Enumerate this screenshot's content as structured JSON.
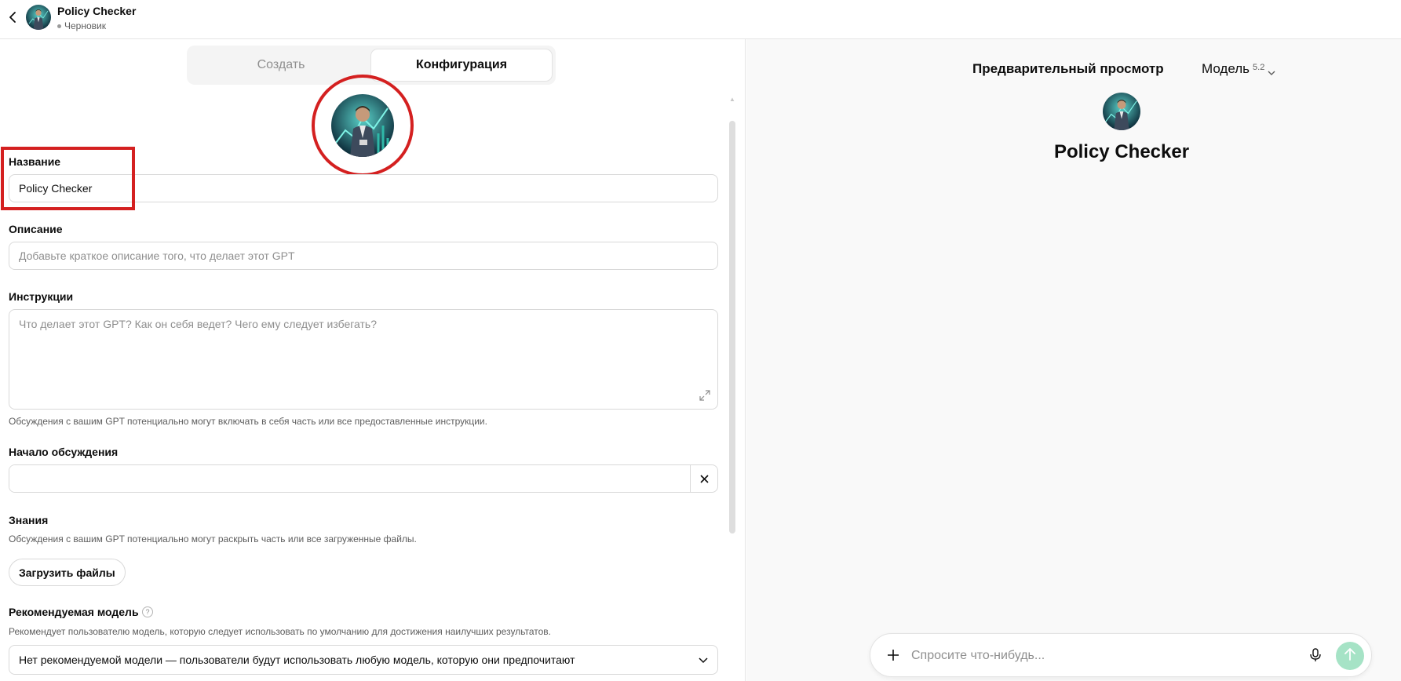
{
  "header": {
    "title": "Policy Checker",
    "status": "Черновик"
  },
  "tabs": [
    {
      "label": "Создать",
      "active": false
    },
    {
      "label": "Конфигурация",
      "active": true
    }
  ],
  "form": {
    "name": {
      "label": "Название",
      "value": "Policy Checker"
    },
    "description": {
      "label": "Описание",
      "placeholder": "Добавьте краткое описание того, что делает этот GPT",
      "value": ""
    },
    "instructions": {
      "label": "Инструкции",
      "placeholder": "Что делает этот GPT? Как он себя ведет? Чего ему следует избегать?",
      "hint": "Обсуждения с вашим GPT потенциально могут включать в себя часть или все предоставленные инструкции."
    },
    "conversation_starters": {
      "label": "Начало обсуждения",
      "value": ""
    },
    "knowledge": {
      "label": "Знания",
      "hint": "Обсуждения с вашим GPT потенциально могут раскрыть часть или все загруженные файлы.",
      "upload_label": "Загрузить файлы"
    },
    "recommended_model": {
      "label": "Рекомендуемая модель",
      "help": "?",
      "hint": "Рекомендует пользователю модель, которую следует использовать по умолчанию для достижения наилучших результатов.",
      "selected": "Нет рекомендуемой модели — пользователи будут использовать любую модель, которую они предпочитают"
    }
  },
  "preview": {
    "title": "Предварительный просмотр",
    "model_label": "Модель",
    "model_version": "5.2",
    "gpt_name": "Policy Checker",
    "composer_placeholder": "Спросите что-нибудь..."
  },
  "colors": {
    "highlight": "#d42020",
    "send_button": "#a6e3c6",
    "preview_bg": "#f9f9f9"
  },
  "icons": [
    "back-arrow-icon",
    "plus-icon",
    "mic-icon",
    "arrow-up-icon",
    "chevron-down-icon",
    "close-icon",
    "expand-icon",
    "help-icon"
  ]
}
